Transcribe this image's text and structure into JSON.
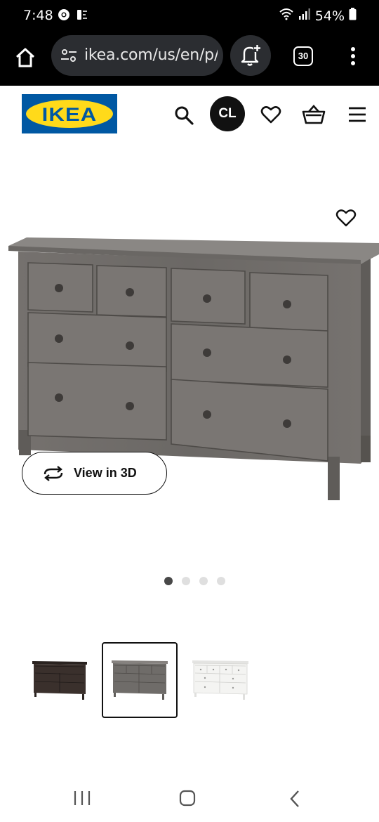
{
  "status_bar": {
    "time": "7:48",
    "battery": "54%",
    "icons": [
      "chrome-icon",
      "notification-icon",
      "wifi-icon",
      "signal-icon",
      "battery-icon"
    ]
  },
  "browser": {
    "url": "ikea.com/us/en/p/",
    "tab_count": "30",
    "icons": [
      "home-icon",
      "site-settings-icon",
      "add-alert-icon",
      "tabs-icon",
      "more-icon"
    ]
  },
  "header": {
    "logo_text": "IKEA",
    "avatar_initials": "CL",
    "icons": [
      "search-icon",
      "heart-icon",
      "basket-icon",
      "menu-icon"
    ],
    "colors": {
      "logo_blue": "#0058a3",
      "logo_yellow": "#ffda1a"
    }
  },
  "product": {
    "image": "gray-8-drawer-dresser",
    "view_3d_label": "View in 3D",
    "carousel": {
      "total": 4,
      "active": 1
    }
  },
  "variants": [
    {
      "name": "black-brown",
      "color": "#3a302c",
      "selected": false
    },
    {
      "name": "dark-gray-stained",
      "color": "#6f6c69",
      "selected": true
    },
    {
      "name": "white-stain",
      "color": "#f2f2f0",
      "selected": false
    }
  ]
}
